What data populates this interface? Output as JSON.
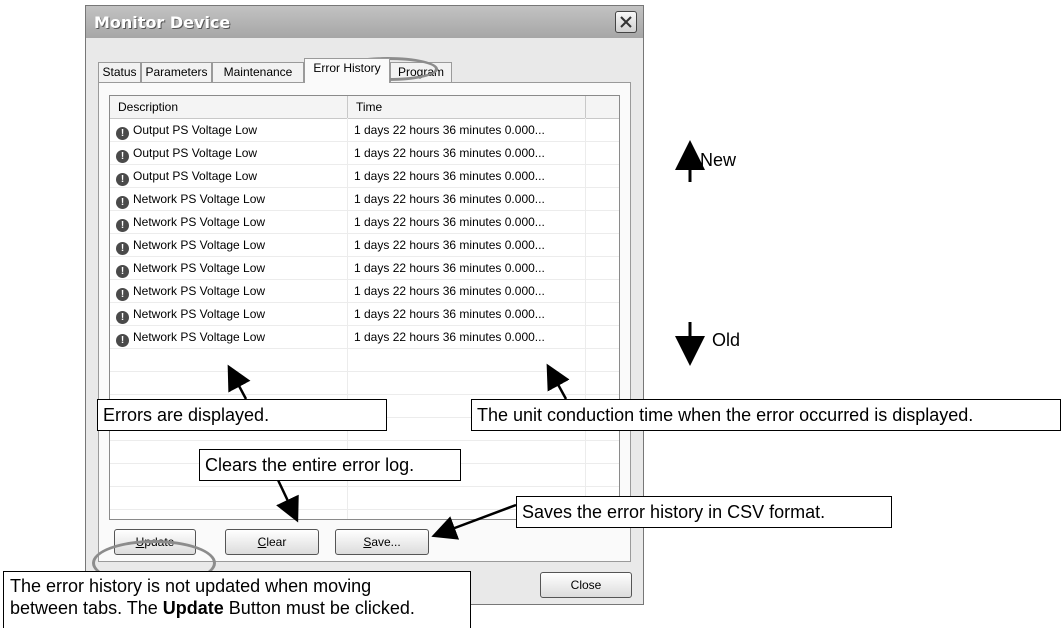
{
  "window": {
    "title": "Monitor Device",
    "tabs": [
      "Status",
      "Parameters",
      "Maintenance",
      "Error History",
      "Program"
    ],
    "active_tab": "Error History",
    "columns": [
      "Description",
      "Time"
    ],
    "rows": [
      {
        "description": "Output PS Voltage Low",
        "time": "1 days 22 hours 36 minutes 0.000..."
      },
      {
        "description": "Output PS Voltage Low",
        "time": "1 days 22 hours 36 minutes 0.000..."
      },
      {
        "description": "Output PS Voltage Low",
        "time": "1 days 22 hours 36 minutes 0.000..."
      },
      {
        "description": "Network PS Voltage Low",
        "time": "1 days 22 hours 36 minutes 0.000..."
      },
      {
        "description": "Network PS Voltage Low",
        "time": "1 days 22 hours 36 minutes 0.000..."
      },
      {
        "description": "Network PS Voltage Low",
        "time": "1 days 22 hours 36 minutes 0.000..."
      },
      {
        "description": "Network PS Voltage Low",
        "time": "1 days 22 hours 36 minutes 0.000..."
      },
      {
        "description": "Network PS Voltage Low",
        "time": "1 days 22 hours 36 minutes 0.000..."
      },
      {
        "description": "Network PS Voltage Low",
        "time": "1 days 22 hours 36 minutes 0.000..."
      },
      {
        "description": "Network PS Voltage Low",
        "time": "1 days 22 hours 36 minutes 0.000..."
      }
    ],
    "buttons": {
      "update_key": "U",
      "update_rest": "pdate",
      "clear_key": "C",
      "clear_rest": "lear",
      "save_key": "S",
      "save_rest": "ave...",
      "close": "Close"
    }
  },
  "annotations": {
    "new": "New",
    "old": "Old",
    "errors_displayed": "Errors are displayed.",
    "time_displayed": "The unit conduction time when the error occurred is displayed.",
    "clears": "Clears the entire error log.",
    "saves": "Saves the error history in CSV format.",
    "note_line1": "The error history is not updated when moving",
    "note_line2_pre": "between tabs. The ",
    "note_line2_bold": "Update",
    "note_line2_post": " Button must be clicked."
  }
}
